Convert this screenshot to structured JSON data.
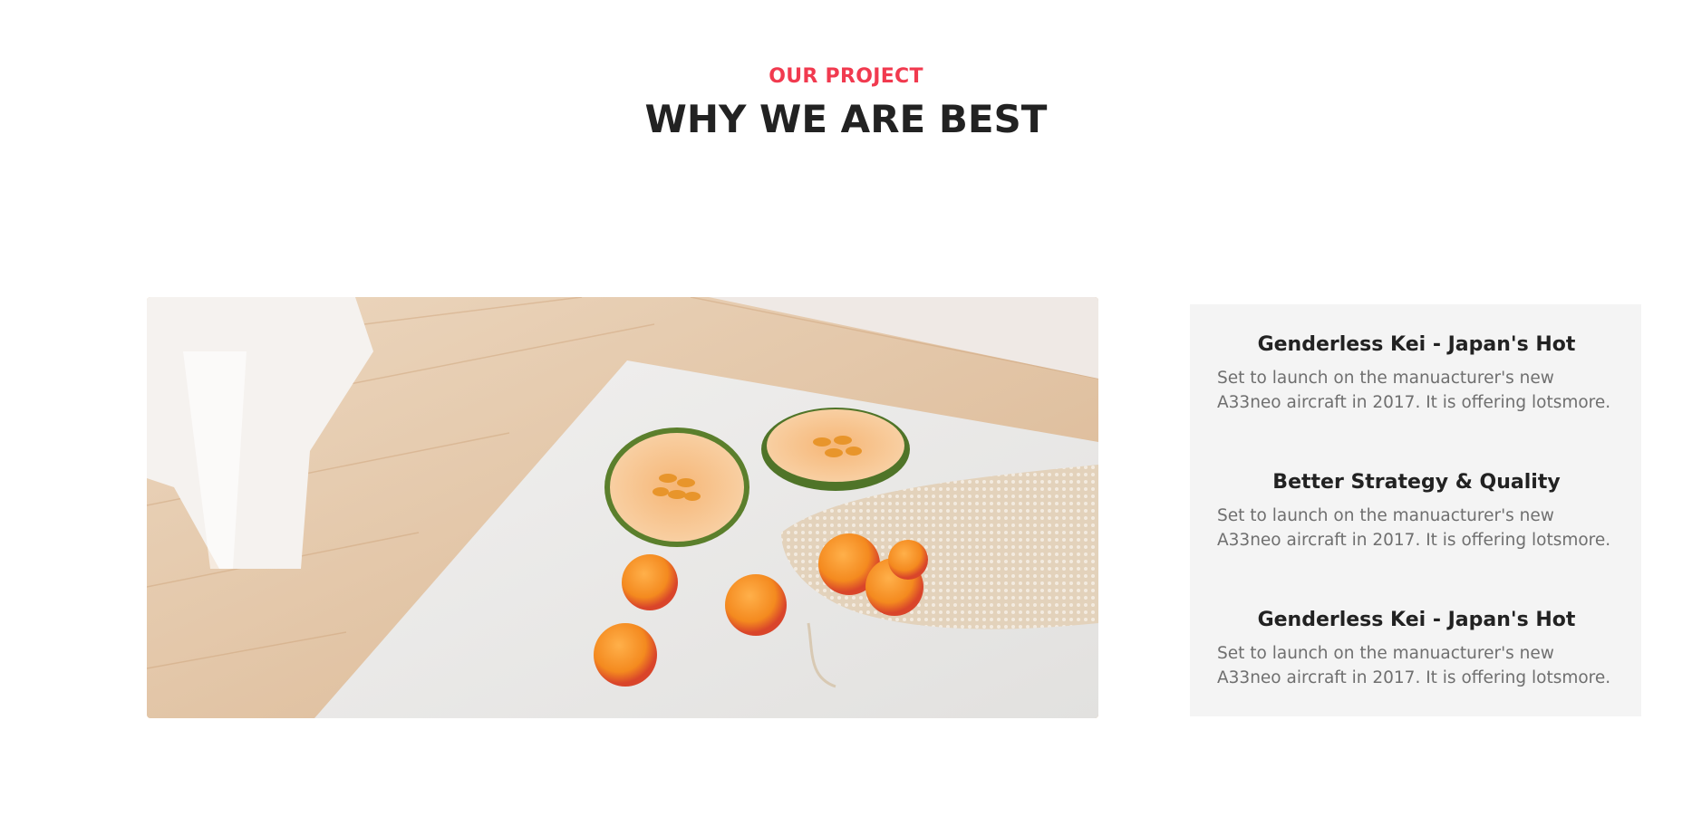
{
  "section": {
    "eyebrow": "OUR PROJECT",
    "title": "WHY WE ARE BEST"
  },
  "features": [
    {
      "title": "Genderless Kei - Japan's Hot",
      "text": "Set to launch on the manuacturer's new A33neo aircraft in 2017. It is offering lotsmore."
    },
    {
      "title": "Better Strategy & Quality",
      "text": "Set to launch on the manuacturer's new A33neo aircraft in 2017. It is offering lotsmore."
    },
    {
      "title": "Genderless Kei - Japan's Hot",
      "text": "Set to launch on the manuacturer's new A33neo aircraft in 2017. It is offering lotsmore."
    }
  ],
  "colors": {
    "accent": "#f13a4f",
    "heading": "#222222",
    "body_text": "#6f6f6f",
    "panel_background": "#f4f4f4"
  }
}
